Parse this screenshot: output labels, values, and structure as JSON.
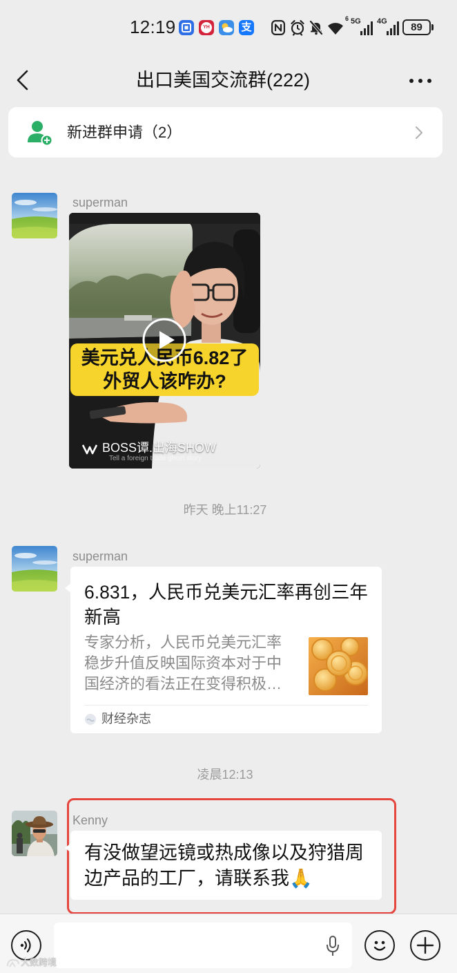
{
  "colors": {
    "page_background": "#ededed",
    "bubble_background": "#ffffff",
    "highlight_border": "#e5453d",
    "accent_green": "#2bae66",
    "video_caption_background": "#f6d42c",
    "secondary_text": "#8a8a8a"
  },
  "status_bar": {
    "time": "12:19",
    "app_icons": [
      "app-notification-icon",
      "yh-app-icon",
      "weather-icon",
      "alipay-icon"
    ],
    "yh_label": "YH",
    "alipay_label": "支",
    "system_icons": [
      "nfc-icon",
      "alarm-icon",
      "mute-icon",
      "wifi-icon",
      "signal-icon",
      "signal-icon",
      "battery-icon"
    ],
    "wifi_badge": "6",
    "signal_1": "5G",
    "signal_2": "4G",
    "battery_level": "89"
  },
  "header": {
    "title": "出口美国交流群(222)",
    "icons": [
      "back-icon",
      "more-icon"
    ]
  },
  "notice": {
    "label": "新进群申请（2）",
    "icon": "add-member-icon"
  },
  "chat": {
    "messages": [
      {
        "sender": "superman",
        "avatar": "landscape-avatar",
        "type": "video",
        "video": {
          "caption_line_1": "美元兑人民币6.82了",
          "caption_line_2": "外贸人该咋办?",
          "channel_watermark": "BOSS谭.出海SHOW",
          "subtitle": "Tell a foreign trade ghost story",
          "play_icon": "play-icon"
        }
      },
      {
        "sender": "superman",
        "avatar": "landscape-avatar",
        "type": "link_card",
        "card": {
          "title": "6.831，人民币兑美元汇率再创三年新高",
          "description": "专家分析，人民币兑美元汇率稳步升值反映国际资本对于中国经济的看法正在变得积极…",
          "source": "财经杂志",
          "thumbnail": "gold-coins-thumbnail"
        }
      },
      {
        "sender": "Kenny",
        "avatar": "man-in-hat-avatar",
        "type": "text",
        "text": "有没做望远镜或热成像以及狩猎周边产品的工厂，请联系我🙏",
        "highlighted": true
      }
    ],
    "timestamps": [
      "昨天 晚上11:27",
      "凌晨12:13"
    ]
  },
  "input_bar": {
    "placeholder": "",
    "icons": [
      "voice-icon",
      "mic-icon",
      "emoji-icon",
      "plus-icon"
    ]
  },
  "watermark": "大数跨境"
}
